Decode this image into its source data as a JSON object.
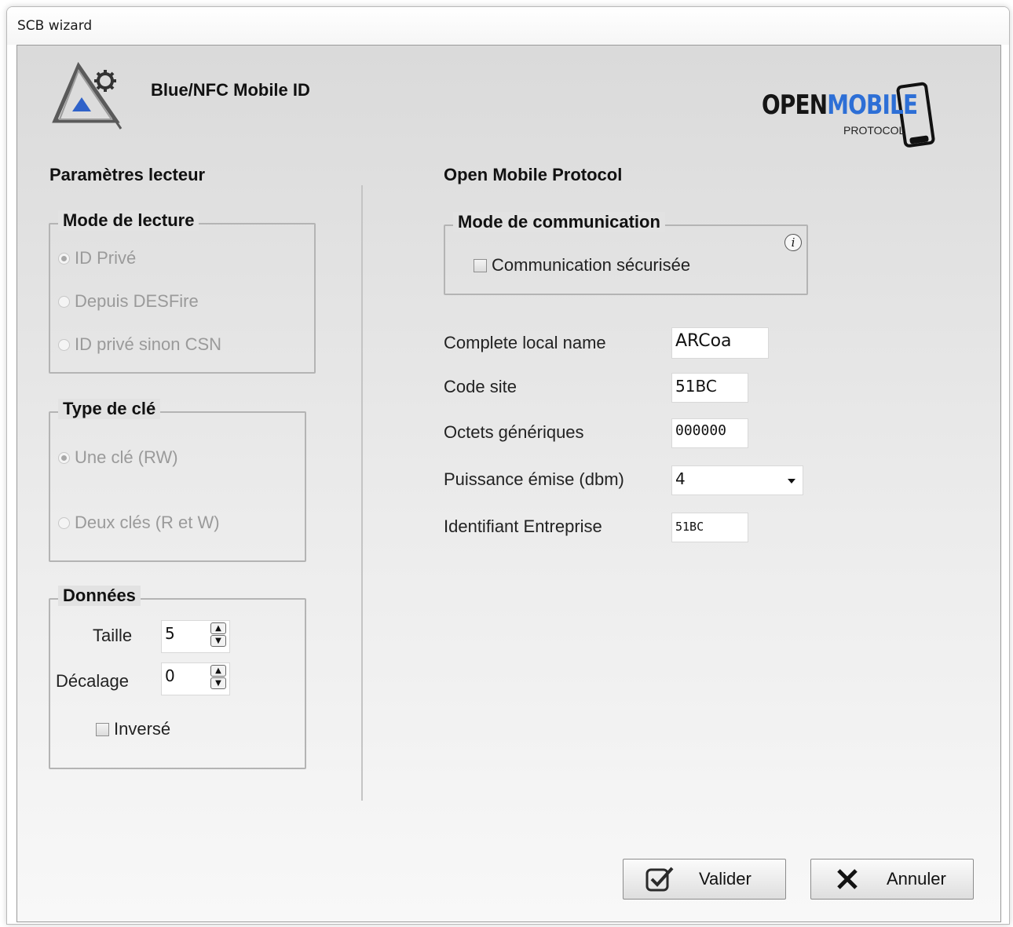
{
  "window": {
    "title": "SCB wizard"
  },
  "header": {
    "app_title": "Blue/NFC Mobile ID",
    "brand": {
      "open": "OPEN",
      "mobile": "MOBILE",
      "protocol": "PROTOCOL"
    }
  },
  "left": {
    "heading": "Paramètres lecteur",
    "mode_lecture": {
      "legend": "Mode de lecture",
      "options": [
        {
          "label": "ID Privé",
          "selected": true
        },
        {
          "label": "Depuis DESFire",
          "selected": false
        },
        {
          "label": "ID privé sinon CSN",
          "selected": false
        }
      ]
    },
    "type_cle": {
      "legend": "Type de clé",
      "options": [
        {
          "label": "Une clé (RW)",
          "selected": true
        },
        {
          "label": "Deux clés (R et W)",
          "selected": false
        }
      ]
    },
    "donnees": {
      "legend": "Données",
      "taille_label": "Taille",
      "taille_value": "5",
      "decalage_label": "Décalage",
      "decalage_value": "0",
      "inverse_label": "Inversé",
      "inverse_checked": false
    }
  },
  "right": {
    "heading": "Open Mobile Protocol",
    "comm": {
      "legend": "Mode de communication",
      "secure_label": "Communication sécurisée",
      "secure_checked": false,
      "info_icon": "info-icon"
    },
    "fields": {
      "local_name_label": "Complete local name",
      "local_name_value": "ARCoa",
      "code_site_label": "Code site",
      "code_site_value": "51BC",
      "octets_label": "Octets génériques",
      "octets_value": "000000",
      "puissance_label": "Puissance émise (dbm)",
      "puissance_value": "4",
      "entreprise_label": "Identifiant Entreprise",
      "entreprise_value": "51BC"
    }
  },
  "buttons": {
    "validate": "Valider",
    "cancel": "Annuler"
  },
  "colors": {
    "brand_blue": "#2d6fd6",
    "logo_blue": "#2f62c9",
    "panel_gray": "#e2e2e2",
    "disabled_text": "#9a9a9a"
  }
}
